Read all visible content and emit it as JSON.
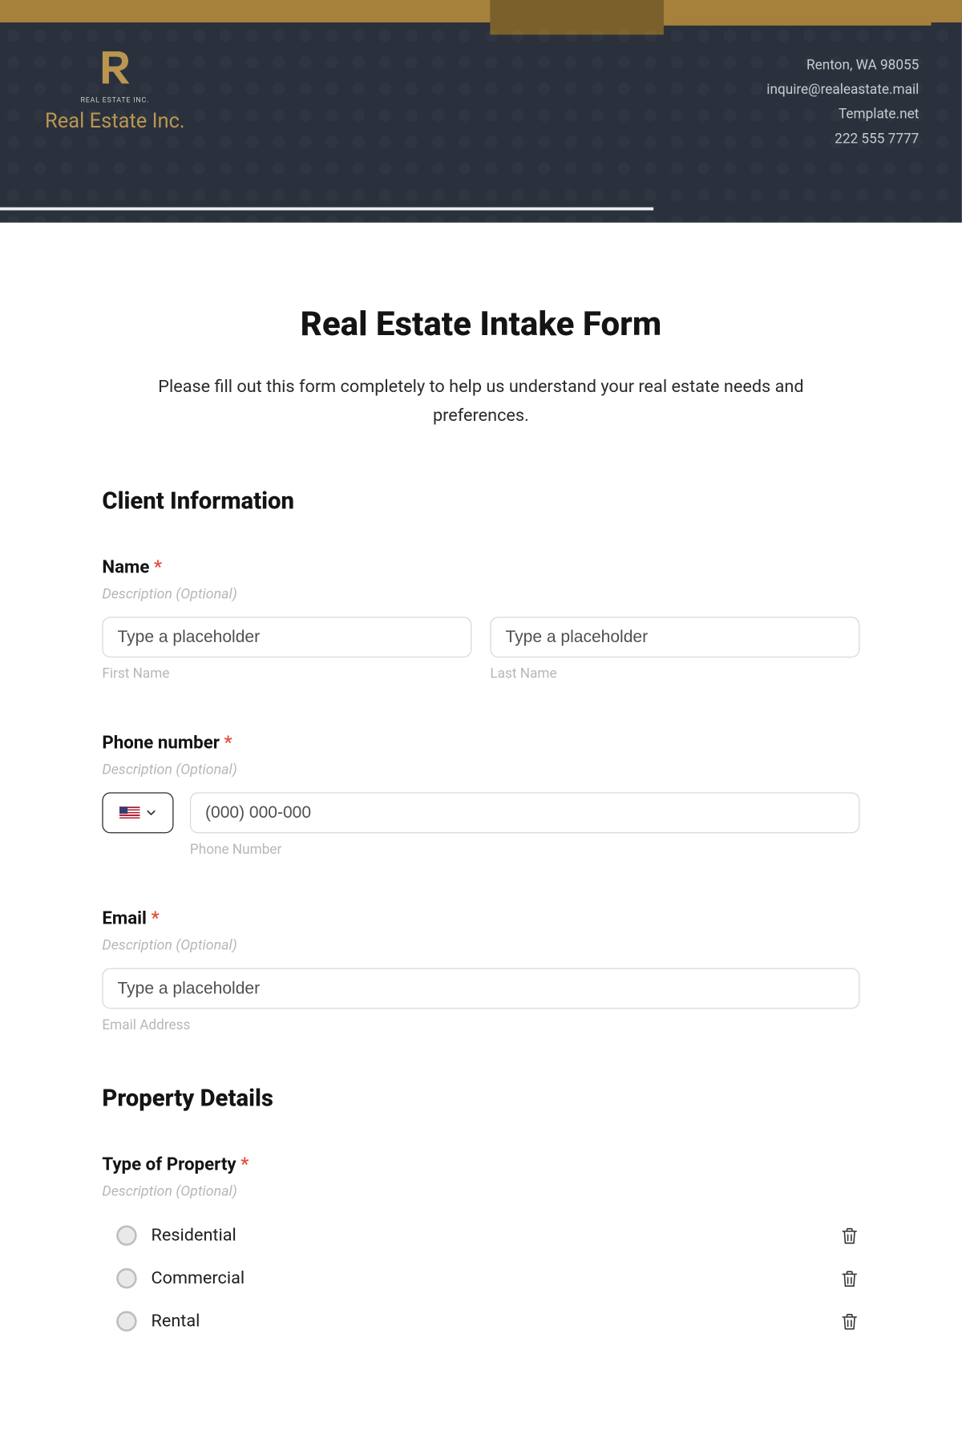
{
  "header": {
    "logo_sub": "REAL ESTATE INC.",
    "company_name": "Real Estate Inc.",
    "contact": {
      "address": "Renton, WA 98055",
      "email": "inquire@realeastate.mail",
      "site": "Template.net",
      "phone": "222 555 7777"
    }
  },
  "form": {
    "title": "Real Estate Intake Form",
    "intro": "Please fill out this form completely to help us understand your real estate needs and preferences."
  },
  "section1_heading": "Client Information",
  "name_field": {
    "label": "Name",
    "desc": "Description (Optional)",
    "placeholder_first": "Type a placeholder",
    "placeholder_last": "Type a placeholder",
    "sub_first": "First Name",
    "sub_last": "Last Name"
  },
  "phone_field": {
    "label": "Phone number",
    "desc": "Description (Optional)",
    "placeholder": "(000) 000-000",
    "sub": "Phone Number"
  },
  "email_field": {
    "label": "Email",
    "desc": "Description (Optional)",
    "placeholder": "Type a placeholder",
    "sub": "Email Address"
  },
  "section2_heading": "Property Details",
  "proptype_field": {
    "label": "Type of Property",
    "desc": "Description (Optional)",
    "options": [
      "Residential",
      "Commercial",
      "Rental"
    ]
  },
  "required_mark": "*"
}
